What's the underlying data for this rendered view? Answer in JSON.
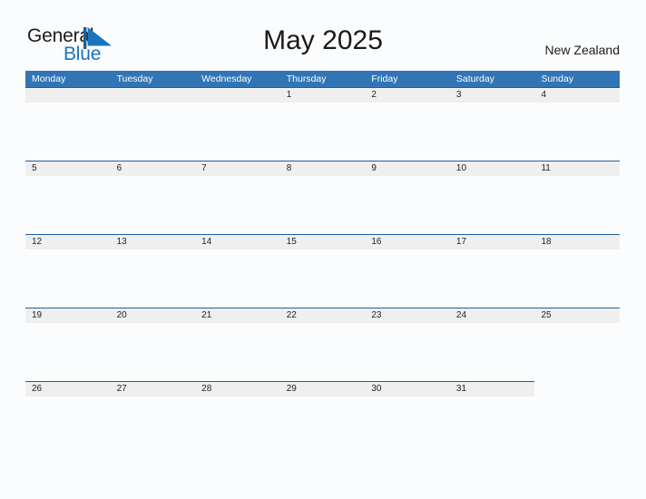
{
  "brand": {
    "line1": "General",
    "line2": "Blue",
    "flag_icon": "blue-flag-triangle",
    "accent_color": "#1b75bc"
  },
  "header": {
    "title": "May 2025",
    "region": "New Zealand"
  },
  "theme": {
    "header_blue": "#3175b5",
    "band_gray": "#efefef",
    "band_border": "#1f5f9e",
    "page_background": "#fbfcfd",
    "text_color": "#222222"
  },
  "calendar": {
    "weekdays": [
      "Monday",
      "Tuesday",
      "Wednesday",
      "Thursday",
      "Friday",
      "Saturday",
      "Sunday"
    ],
    "weeks": [
      {
        "days": [
          {
            "number": "",
            "has_band": true
          },
          {
            "number": "",
            "has_band": true
          },
          {
            "number": "",
            "has_band": true
          },
          {
            "number": "1",
            "has_band": true
          },
          {
            "number": "2",
            "has_band": true
          },
          {
            "number": "3",
            "has_band": true
          },
          {
            "number": "4",
            "has_band": true
          }
        ]
      },
      {
        "days": [
          {
            "number": "5",
            "has_band": true
          },
          {
            "number": "6",
            "has_band": true
          },
          {
            "number": "7",
            "has_band": true
          },
          {
            "number": "8",
            "has_band": true
          },
          {
            "number": "9",
            "has_band": true
          },
          {
            "number": "10",
            "has_band": true
          },
          {
            "number": "11",
            "has_band": true
          }
        ]
      },
      {
        "days": [
          {
            "number": "12",
            "has_band": true
          },
          {
            "number": "13",
            "has_band": true
          },
          {
            "number": "14",
            "has_band": true
          },
          {
            "number": "15",
            "has_band": true
          },
          {
            "number": "16",
            "has_band": true
          },
          {
            "number": "17",
            "has_band": true
          },
          {
            "number": "18",
            "has_band": true
          }
        ]
      },
      {
        "days": [
          {
            "number": "19",
            "has_band": true
          },
          {
            "number": "20",
            "has_band": true
          },
          {
            "number": "21",
            "has_band": true
          },
          {
            "number": "22",
            "has_band": true
          },
          {
            "number": "23",
            "has_band": true
          },
          {
            "number": "24",
            "has_band": true
          },
          {
            "number": "25",
            "has_band": true
          }
        ]
      },
      {
        "days": [
          {
            "number": "26",
            "has_band": true
          },
          {
            "number": "27",
            "has_band": true
          },
          {
            "number": "28",
            "has_band": true
          },
          {
            "number": "29",
            "has_band": true
          },
          {
            "number": "30",
            "has_band": true
          },
          {
            "number": "31",
            "has_band": true
          },
          {
            "number": "",
            "has_band": false
          }
        ]
      }
    ]
  }
}
